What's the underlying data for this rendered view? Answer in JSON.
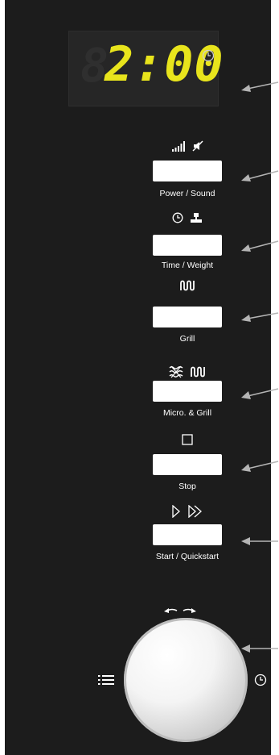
{
  "display": {
    "ghost_digit": "8",
    "time": "2:00",
    "clock_indicator_icon": "clock-icon"
  },
  "buttons": [
    {
      "id": "power-sound",
      "label": "Power / Sound",
      "icons": [
        "signal-bars-icon",
        "mute-speaker-icon"
      ]
    },
    {
      "id": "time-weight",
      "label": "Time / Weight",
      "icons": [
        "clock-icon",
        "scale-icon"
      ]
    },
    {
      "id": "grill",
      "label": "Grill",
      "icons": [
        "grill-icon"
      ]
    },
    {
      "id": "micro-grill",
      "label": "Micro. & Grill",
      "icons": [
        "microwave-waves-icon",
        "grill-icon"
      ]
    },
    {
      "id": "stop",
      "label": "Stop",
      "icons": [
        "stop-square-icon"
      ]
    },
    {
      "id": "start-quickstart",
      "label": "Start / Quickstart",
      "icons": [
        "play-icon",
        "fast-forward-icon"
      ]
    }
  ],
  "dial": {
    "left_icon": "menu-list-icon",
    "right_icon": "clock-icon",
    "rotation_icon": "rotate-arrows-icon"
  },
  "colors": {
    "panel": "#1c1c1c",
    "display_digits": "#e8e41c",
    "arrow": "#b4b4b4"
  }
}
